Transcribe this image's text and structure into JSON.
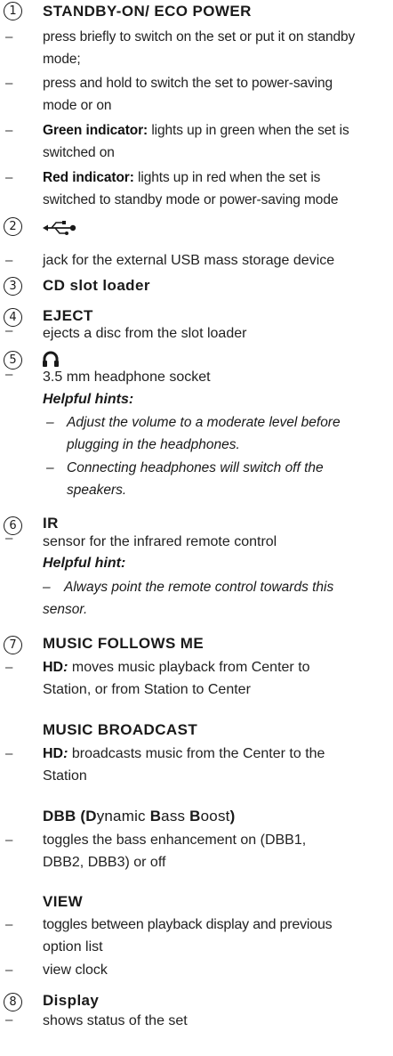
{
  "items": {
    "i1": {
      "num": "1",
      "title": "STANDBY-ON/ ECO POWER",
      "l1": "press briefly to switch on the set or put it on standby",
      "l1b": "mode;",
      "l2": "press and hold to switch the set to power-saving",
      "l2b": "mode or on",
      "green_label": "Green indicator:",
      "green_text": " lights up in green when the set is",
      "green_text_b": "switched on",
      "red_label": "Red indicator:",
      "red_text": " lights up in red when the set is",
      "red_text_b": "switched to standby mode or power-saving mode"
    },
    "i2": {
      "num": "2",
      "icon": "usb-icon",
      "l1": "jack for the external USB mass storage device"
    },
    "i3": {
      "num": "3",
      "title": "CD slot loader"
    },
    "i4": {
      "num": "4",
      "title": "EJECT",
      "l1": "ejects a disc from the slot loader"
    },
    "i5": {
      "num": "5",
      "icon": "headphones-icon",
      "l1": "3.5 mm headphone socket",
      "hint_title": "Helpful hints:",
      "h1a": "Adjust the volume to a moderate level before",
      "h1b": "plugging in the headphones.",
      "h2a": "Connecting headphones will switch off the",
      "h2b": "speakers."
    },
    "i6": {
      "num": "6",
      "title": "IR",
      "l1": "sensor for the infrared remote control",
      "hint_title": "Helpful hint:",
      "h1a": "Always point the remote control towards this",
      "h1b": "sensor."
    },
    "i7": {
      "num": "7",
      "title": "MUSIC FOLLOWS ME",
      "l1_label": "HD",
      "l1_colon": ":",
      "l1": " moves music playback from Center to",
      "l1b": "Station, or from Station to Center",
      "title2": "MUSIC BROADCAST",
      "l2_label": "HD",
      "l2_colon": ":",
      "l2": " broadcasts music from the Center to the",
      "l2b": "Station",
      "title3_d": "D",
      "title3_a": "DBB (",
      "title3_b": "ynamic ",
      "title3_B1": "B",
      "title3_c": "ass ",
      "title3_B2": "B",
      "title3_d2": "oost",
      "title3_e": ")",
      "l3": "toggles the bass enhancement on (DBB1,",
      "l3b": "DBB2, DBB3) or off",
      "title4": "VIEW",
      "l4": "toggles between playback display and previous",
      "l4b": "option list",
      "l5": "view clock"
    },
    "i8": {
      "num": "8",
      "title": "Display",
      "l1": "shows status of the set"
    }
  },
  "dash_char": "–"
}
